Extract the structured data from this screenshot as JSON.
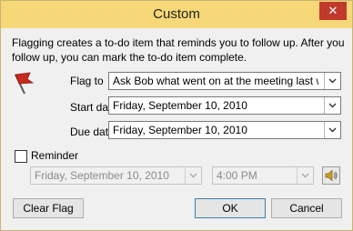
{
  "window": {
    "title": "Custom",
    "close_label": "✕"
  },
  "description": "Flagging creates a to-do item that reminds you to follow up. After you follow up, you can mark the to-do item complete.",
  "flag_to": {
    "label": "Flag to",
    "value": "Ask Bob what went on at the meeting last we"
  },
  "start_date": {
    "label": "Start date",
    "value": "Friday, September 10, 2010"
  },
  "due_date": {
    "label": "Due date",
    "value": "Friday, September 10, 2010"
  },
  "reminder": {
    "label": "Reminder",
    "checked": false,
    "date_value": "Friday, September 10, 2010",
    "time_value": "4:00 PM"
  },
  "buttons": {
    "clear_flag": "Clear Flag",
    "ok": "OK",
    "cancel": "Cancel"
  },
  "icons": {
    "flag": "red-flag-icon",
    "sound": "speaker-icon"
  },
  "colors": {
    "titlebar": "#f6d878",
    "close": "#c0392b",
    "default_border": "#3c7fb1",
    "flag": "#c8281e"
  }
}
